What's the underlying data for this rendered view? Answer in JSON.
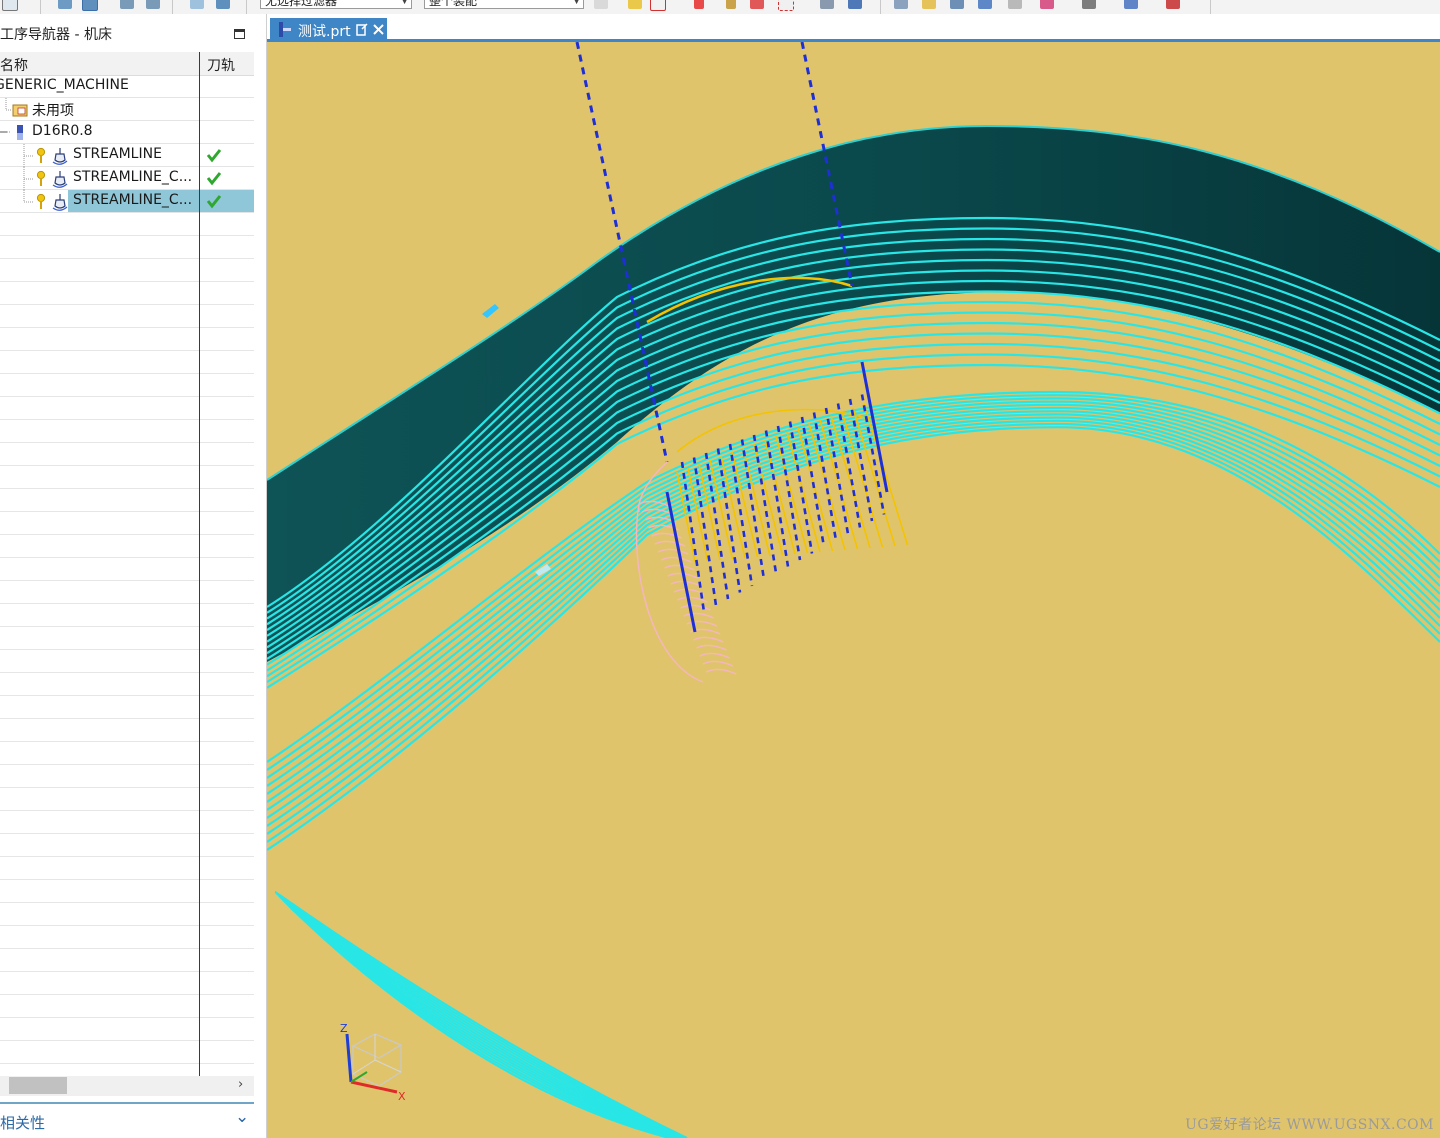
{
  "toolbar": {
    "filter_combo": "无选择过滤器",
    "assembly_combo": "整个装配"
  },
  "navigator": {
    "title": "工序导航器 - 机床",
    "columns": {
      "name": "名称",
      "toolpath": "刀轨"
    },
    "rows": [
      {
        "label": "GENERIC_MACHINE"
      },
      {
        "label": "未用项"
      },
      {
        "label": "D16R0.8"
      },
      {
        "label": "STREAMLINE",
        "status": "check"
      },
      {
        "label": "STREAMLINE_C...",
        "status": "check"
      },
      {
        "label": "STREAMLINE_C...",
        "status": "check",
        "selected": true
      }
    ]
  },
  "relations_panel": {
    "label": "相关性"
  },
  "document_tab": {
    "label": "测试.prt"
  },
  "viewport": {
    "triad": {
      "z_label": "Z",
      "x_label": "X"
    },
    "colors": {
      "part_surface": "#e0c46c",
      "wall": "#0b4a4e",
      "toolpath": "#29e6e6",
      "engage": "#1e2fd6",
      "selected_tool": "#f4b6c2",
      "arc": "#f3c300"
    }
  },
  "watermark": "UG爱好者论坛 WWW.UGSNX.COM"
}
